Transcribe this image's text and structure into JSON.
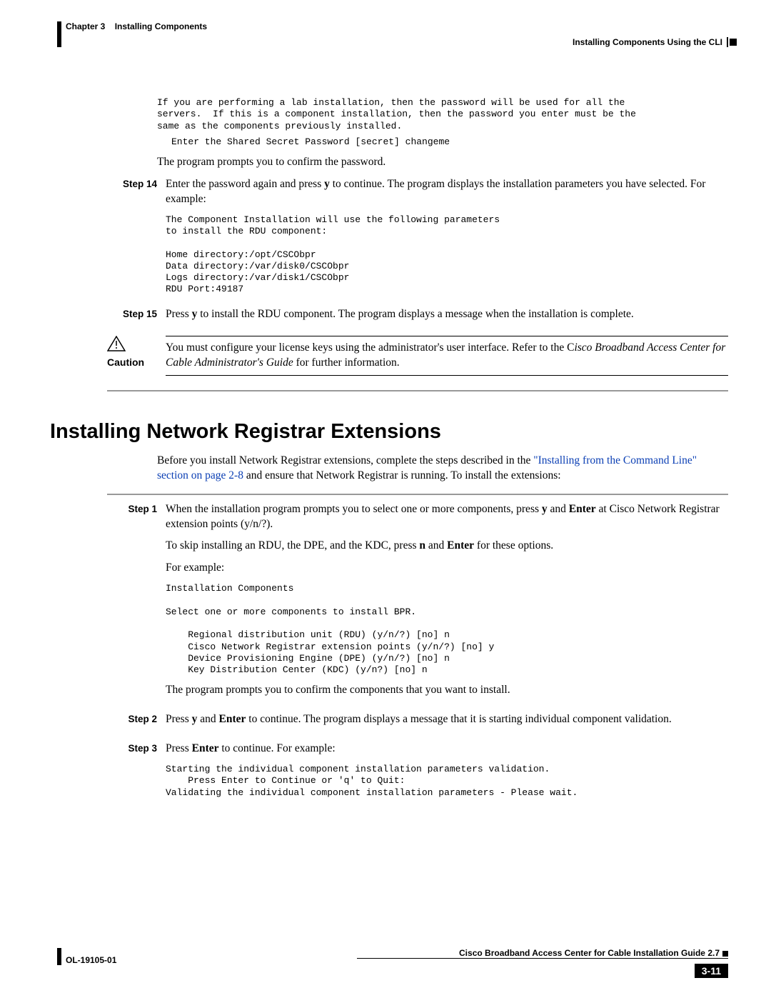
{
  "header": {
    "chapter": "Chapter 3",
    "title": "Installing Components",
    "section": "Installing Components Using the CLI"
  },
  "intro": {
    "para1": "If you are performing a lab installation, then the password will be used for all the\nservers.  If this is a component installation, then the password you enter must be the\nsame as the components previously installed.",
    "code1": "Enter the Shared Secret Password [secret] changeme",
    "para2": "The program prompts you to confirm the password."
  },
  "steps_a": {
    "s14": {
      "label": "Step 14",
      "text_a": "Enter the password again and press ",
      "key1": "y",
      "text_b": " to continue. The program displays the installation parameters you have selected. For example:",
      "code": "The Component Installation will use the following parameters\nto install the RDU component:\n\nHome directory:/opt/CSCObpr\nData directory:/var/disk0/CSCObpr\nLogs directory:/var/disk1/CSCObpr\nRDU Port:49187"
    },
    "s15": {
      "label": "Step 15",
      "text_a": "Press ",
      "key1": "y",
      "text_b": " to install the RDU component. The program displays a message when the installation is complete."
    }
  },
  "caution": {
    "label": "Caution",
    "text_a": "You must configure your license keys using the administrator's user interface. Refer to the ",
    "doc_prefix": "C",
    "doc_italic": "isco Broadband Access Center for Cable Administrator's Guide",
    "text_b": " for further information."
  },
  "section": {
    "heading": "Installing Network Registrar Extensions",
    "intro_a": "Before you install Network Registrar extensions, complete the steps described in the ",
    "link": "\"Installing from the Command Line\" section on page 2-8",
    "intro_b": " and ensure that Network Registrar is running. To install the extensions:"
  },
  "steps_b": {
    "s1": {
      "label": "Step 1",
      "p1_a": "When the installation program prompts you to select one or more components, press ",
      "key1": "y",
      "p1_b": " and ",
      "key2": "Enter",
      "p1_c": " at Cisco Network Registrar extension points (y/n/?).",
      "p2_a": "To skip installing an RDU, the DPE, and the KDC, press ",
      "key3": "n",
      "p2_b": " and ",
      "key4": "Enter",
      "p2_c": " for these options.",
      "p3": "For example:",
      "code": "Installation Components\n\nSelect one or more components to install BPR.\n\n    Regional distribution unit (RDU) (y/n/?) [no] n\n    Cisco Network Registrar extension points (y/n/?) [no] y\n    Device Provisioning Engine (DPE) (y/n/?) [no] n\n    Key Distribution Center (KDC) (y/n?) [no] n",
      "p4": "The program prompts you to confirm the components that you want to install."
    },
    "s2": {
      "label": "Step 2",
      "text_a": "Press ",
      "key1": "y",
      "text_b": " and ",
      "key2": "Enter",
      "text_c": " to continue. The program displays a message that it is starting individual component validation."
    },
    "s3": {
      "label": "Step 3",
      "text_a": "Press ",
      "key1": "Enter",
      "text_b": " to continue. For example:",
      "code": "Starting the individual component installation parameters validation.\n    Press Enter to Continue or 'q' to Quit:\nValidating the individual component installation parameters - Please wait."
    }
  },
  "footer": {
    "doc": "Cisco Broadband Access Center for Cable Installation Guide 2.7",
    "ol": "OL-19105-01",
    "pagenum": "3-11"
  }
}
